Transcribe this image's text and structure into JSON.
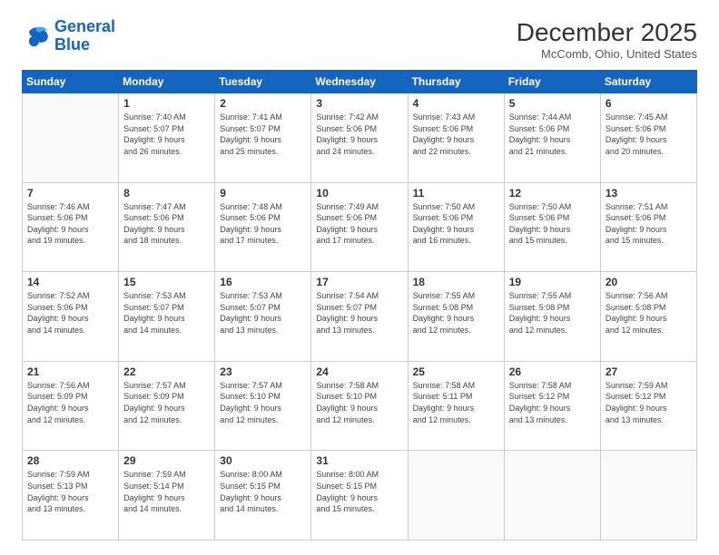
{
  "header": {
    "logo_line1": "General",
    "logo_line2": "Blue",
    "month": "December 2025",
    "location": "McComb, Ohio, United States"
  },
  "weekdays": [
    "Sunday",
    "Monday",
    "Tuesday",
    "Wednesday",
    "Thursday",
    "Friday",
    "Saturday"
  ],
  "weeks": [
    [
      {
        "day": "",
        "info": ""
      },
      {
        "day": "1",
        "info": "Sunrise: 7:40 AM\nSunset: 5:07 PM\nDaylight: 9 hours\nand 26 minutes."
      },
      {
        "day": "2",
        "info": "Sunrise: 7:41 AM\nSunset: 5:07 PM\nDaylight: 9 hours\nand 25 minutes."
      },
      {
        "day": "3",
        "info": "Sunrise: 7:42 AM\nSunset: 5:06 PM\nDaylight: 9 hours\nand 24 minutes."
      },
      {
        "day": "4",
        "info": "Sunrise: 7:43 AM\nSunset: 5:06 PM\nDaylight: 9 hours\nand 22 minutes."
      },
      {
        "day": "5",
        "info": "Sunrise: 7:44 AM\nSunset: 5:06 PM\nDaylight: 9 hours\nand 21 minutes."
      },
      {
        "day": "6",
        "info": "Sunrise: 7:45 AM\nSunset: 5:06 PM\nDaylight: 9 hours\nand 20 minutes."
      }
    ],
    [
      {
        "day": "7",
        "info": "Sunrise: 7:46 AM\nSunset: 5:06 PM\nDaylight: 9 hours\nand 19 minutes."
      },
      {
        "day": "8",
        "info": "Sunrise: 7:47 AM\nSunset: 5:06 PM\nDaylight: 9 hours\nand 18 minutes."
      },
      {
        "day": "9",
        "info": "Sunrise: 7:48 AM\nSunset: 5:06 PM\nDaylight: 9 hours\nand 17 minutes."
      },
      {
        "day": "10",
        "info": "Sunrise: 7:49 AM\nSunset: 5:06 PM\nDaylight: 9 hours\nand 17 minutes."
      },
      {
        "day": "11",
        "info": "Sunrise: 7:50 AM\nSunset: 5:06 PM\nDaylight: 9 hours\nand 16 minutes."
      },
      {
        "day": "12",
        "info": "Sunrise: 7:50 AM\nSunset: 5:06 PM\nDaylight: 9 hours\nand 15 minutes."
      },
      {
        "day": "13",
        "info": "Sunrise: 7:51 AM\nSunset: 5:06 PM\nDaylight: 9 hours\nand 15 minutes."
      }
    ],
    [
      {
        "day": "14",
        "info": "Sunrise: 7:52 AM\nSunset: 5:06 PM\nDaylight: 9 hours\nand 14 minutes."
      },
      {
        "day": "15",
        "info": "Sunrise: 7:53 AM\nSunset: 5:07 PM\nDaylight: 9 hours\nand 14 minutes."
      },
      {
        "day": "16",
        "info": "Sunrise: 7:53 AM\nSunset: 5:07 PM\nDaylight: 9 hours\nand 13 minutes."
      },
      {
        "day": "17",
        "info": "Sunrise: 7:54 AM\nSunset: 5:07 PM\nDaylight: 9 hours\nand 13 minutes."
      },
      {
        "day": "18",
        "info": "Sunrise: 7:55 AM\nSunset: 5:08 PM\nDaylight: 9 hours\nand 12 minutes."
      },
      {
        "day": "19",
        "info": "Sunrise: 7:55 AM\nSunset: 5:08 PM\nDaylight: 9 hours\nand 12 minutes."
      },
      {
        "day": "20",
        "info": "Sunrise: 7:56 AM\nSunset: 5:08 PM\nDaylight: 9 hours\nand 12 minutes."
      }
    ],
    [
      {
        "day": "21",
        "info": "Sunrise: 7:56 AM\nSunset: 5:09 PM\nDaylight: 9 hours\nand 12 minutes."
      },
      {
        "day": "22",
        "info": "Sunrise: 7:57 AM\nSunset: 5:09 PM\nDaylight: 9 hours\nand 12 minutes."
      },
      {
        "day": "23",
        "info": "Sunrise: 7:57 AM\nSunset: 5:10 PM\nDaylight: 9 hours\nand 12 minutes."
      },
      {
        "day": "24",
        "info": "Sunrise: 7:58 AM\nSunset: 5:10 PM\nDaylight: 9 hours\nand 12 minutes."
      },
      {
        "day": "25",
        "info": "Sunrise: 7:58 AM\nSunset: 5:11 PM\nDaylight: 9 hours\nand 12 minutes."
      },
      {
        "day": "26",
        "info": "Sunrise: 7:58 AM\nSunset: 5:12 PM\nDaylight: 9 hours\nand 13 minutes."
      },
      {
        "day": "27",
        "info": "Sunrise: 7:59 AM\nSunset: 5:12 PM\nDaylight: 9 hours\nand 13 minutes."
      }
    ],
    [
      {
        "day": "28",
        "info": "Sunrise: 7:59 AM\nSunset: 5:13 PM\nDaylight: 9 hours\nand 13 minutes."
      },
      {
        "day": "29",
        "info": "Sunrise: 7:59 AM\nSunset: 5:14 PM\nDaylight: 9 hours\nand 14 minutes."
      },
      {
        "day": "30",
        "info": "Sunrise: 8:00 AM\nSunset: 5:15 PM\nDaylight: 9 hours\nand 14 minutes."
      },
      {
        "day": "31",
        "info": "Sunrise: 8:00 AM\nSunset: 5:15 PM\nDaylight: 9 hours\nand 15 minutes."
      },
      {
        "day": "",
        "info": ""
      },
      {
        "day": "",
        "info": ""
      },
      {
        "day": "",
        "info": ""
      }
    ]
  ]
}
